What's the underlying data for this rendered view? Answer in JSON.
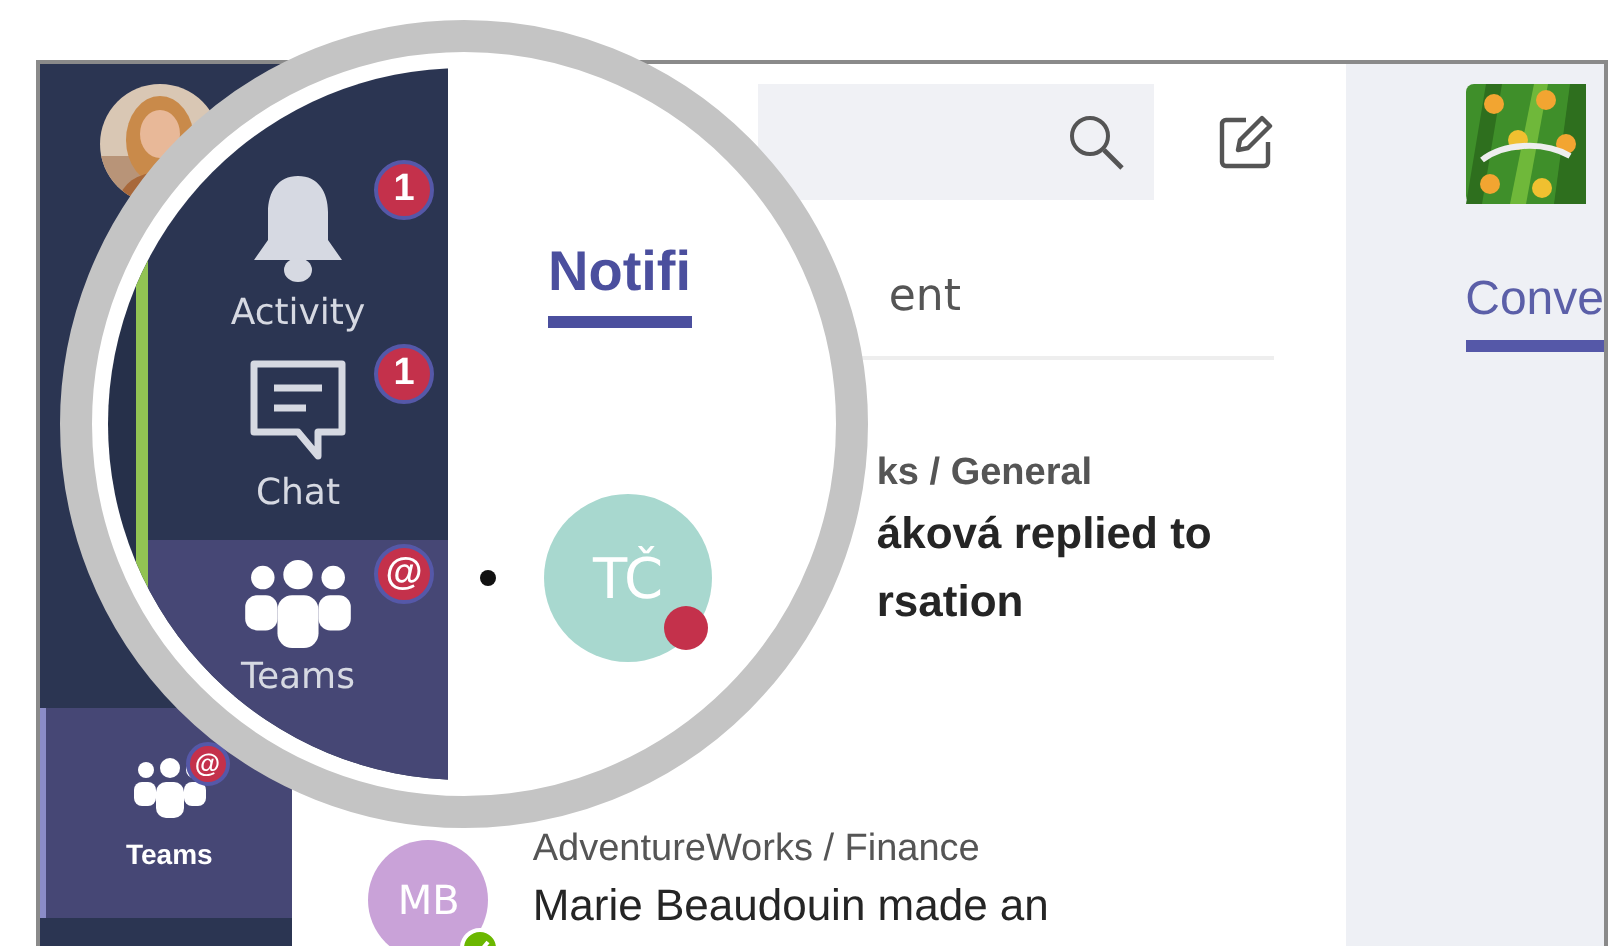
{
  "rail": {
    "item": {
      "label": "Teams",
      "badge": "@",
      "selected": true
    }
  },
  "magnifier": {
    "rail": [
      {
        "kind": "activity",
        "label": "Activity",
        "badge": "1",
        "selected": false
      },
      {
        "kind": "chat",
        "label": "Chat",
        "badge": "1",
        "selected": false
      },
      {
        "kind": "teams",
        "label": "Teams",
        "badge": "@",
        "selected": true
      }
    ],
    "tab": {
      "label": "Notifi",
      "selected": true
    },
    "notification": {
      "initials": "TČ",
      "unread": true
    }
  },
  "feed": {
    "tab_fragment": "ent",
    "items": [
      {
        "kind": "reply",
        "channel": "ks / General",
        "lines": [
          "áková replied to",
          "rsation"
        ]
      },
      {
        "kind": "post",
        "initials": "MB",
        "channel": "AdventureWorks / Finance",
        "lines": [
          "Marie Beaudouin made an"
        ]
      }
    ]
  },
  "team_panel": {
    "tab": {
      "label": "Conve",
      "selected": true
    }
  }
}
